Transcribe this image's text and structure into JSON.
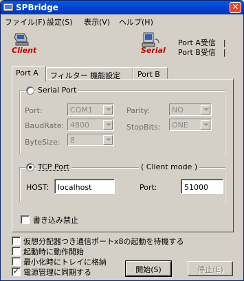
{
  "window": {
    "title": "SPBridge",
    "close_glyph": "✕"
  },
  "menu": [
    {
      "label": "ファイル(F)"
    },
    {
      "label": "設定(S)"
    },
    {
      "label": "表示(V)"
    },
    {
      "label": "ヘルプ(H)"
    }
  ],
  "header": {
    "client_label": "Client",
    "serial_label": "Serial",
    "status_lines": [
      "Port A受信　|",
      "Port B受信　|"
    ],
    "label_color": "#c00000"
  },
  "tabs": [
    {
      "label": "Port A",
      "active": true
    },
    {
      "label": "フィルター 機能設定",
      "active": false
    },
    {
      "label": "Port B",
      "active": false
    }
  ],
  "serial_port": {
    "label": "Serial Port",
    "selected": false,
    "port_label": "Port:",
    "port_value": "COM1",
    "baudrate_label": "BaudRate:",
    "baudrate_value": "4800",
    "bytesize_label": "ByteSize:",
    "bytesize_value": "8",
    "parity_label": "Parity:",
    "parity_value": "NO",
    "stopbits_label": "StopBits:",
    "stopbits_value": "ONE"
  },
  "tcp_port": {
    "label": "TCP Port",
    "selected": true,
    "mode_label": "( Client mode )",
    "host_label": "HOST:",
    "host_value": "localhost",
    "port_label": "Port:",
    "port_value": "51000"
  },
  "write_protect": {
    "label": "書き込み禁止",
    "checked": false
  },
  "options": [
    {
      "label": "仮想分配器つき通信ポートx8の起動を待機する",
      "checked": false
    },
    {
      "label": "起動時に動作開始",
      "checked": false
    },
    {
      "label": "最小化時にトレイに格納",
      "checked": false
    },
    {
      "label": "電源管理に同期する",
      "checked": true
    }
  ],
  "buttons": {
    "start": "開始(S)",
    "stop": "停止(E)"
  },
  "check_glyph": "✓"
}
